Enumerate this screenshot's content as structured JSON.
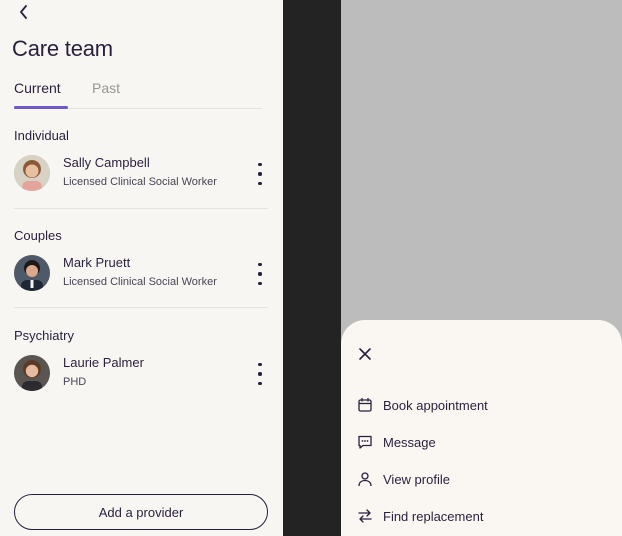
{
  "header": {
    "title": "Care team",
    "back_icon": "chevron-left-icon"
  },
  "tabs": [
    {
      "label": "Current",
      "active": true
    },
    {
      "label": "Past",
      "active": false
    }
  ],
  "sections": [
    {
      "title": "Individual",
      "provider": {
        "name": "Sally Campbell",
        "role": "Licensed Clinical Social Worker"
      }
    },
    {
      "title": "Couples",
      "provider": {
        "name": "Mark Pruett",
        "role": "Licensed Clinical Social Worker"
      }
    },
    {
      "title": "Psychiatry",
      "provider": {
        "name": "Laurie Palmer",
        "role": "PHD"
      }
    }
  ],
  "footer": {
    "add_label": "Add a provider"
  },
  "sheet": {
    "close_icon": "close-icon",
    "items": [
      {
        "label": "Book appointment",
        "icon": "calendar-icon"
      },
      {
        "label": "Message",
        "icon": "message-icon"
      },
      {
        "label": "View profile",
        "icon": "person-icon"
      },
      {
        "label": "Find replacement",
        "icon": "swap-icon"
      }
    ]
  },
  "colors": {
    "accent": "#6f5acb",
    "text": "#2a1f3d",
    "muted": "#9a958f",
    "panel_bg": "#f8f6f2",
    "overlay": "#bcbcbd",
    "sheet_bg": "#faf7f2"
  }
}
